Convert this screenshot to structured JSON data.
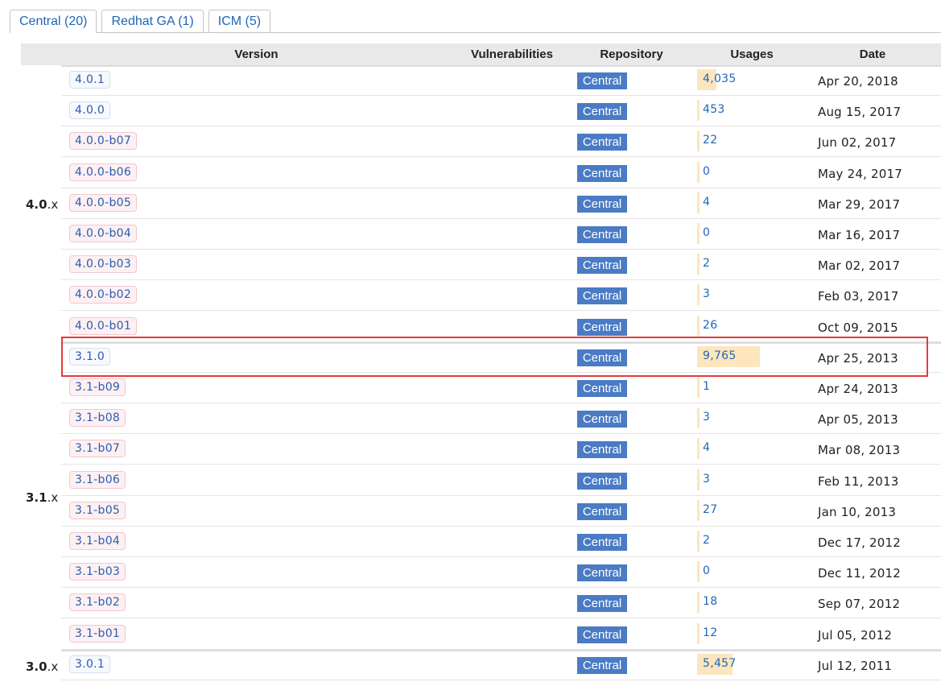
{
  "tabs": [
    {
      "label": "Central (20)",
      "active": true
    },
    {
      "label": "Redhat GA (1)",
      "active": false
    },
    {
      "label": "ICM (5)",
      "active": false
    }
  ],
  "columns": {
    "version": "Version",
    "vulnerabilities": "Vulnerabilities",
    "repository": "Repository",
    "usages": "Usages",
    "date": "Date"
  },
  "groups": [
    {
      "major": "4.0",
      "suffix": ".x"
    },
    {
      "major": "3.1",
      "suffix": ".x"
    },
    {
      "major": "3.0",
      "suffix": ".x"
    }
  ],
  "rows": [
    {
      "version": "4.0.1",
      "release": true,
      "repo": "Central",
      "usages": "4,035",
      "usage_fraction": 0.31,
      "date": "Apr 20, 2018"
    },
    {
      "version": "4.0.0",
      "release": true,
      "repo": "Central",
      "usages": "453",
      "usage_fraction": 0.03,
      "date": "Aug 15, 2017"
    },
    {
      "version": "4.0.0-b07",
      "release": false,
      "repo": "Central",
      "usages": "22",
      "usage_fraction": 0.0,
      "date": "Jun 02, 2017"
    },
    {
      "version": "4.0.0-b06",
      "release": false,
      "repo": "Central",
      "usages": "0",
      "usage_fraction": 0.0,
      "date": "May 24, 2017"
    },
    {
      "version": "4.0.0-b05",
      "release": false,
      "repo": "Central",
      "usages": "4",
      "usage_fraction": 0.0,
      "date": "Mar 29, 2017"
    },
    {
      "version": "4.0.0-b04",
      "release": false,
      "repo": "Central",
      "usages": "0",
      "usage_fraction": 0.0,
      "date": "Mar 16, 2017"
    },
    {
      "version": "4.0.0-b03",
      "release": false,
      "repo": "Central",
      "usages": "2",
      "usage_fraction": 0.0,
      "date": "Mar 02, 2017"
    },
    {
      "version": "4.0.0-b02",
      "release": false,
      "repo": "Central",
      "usages": "3",
      "usage_fraction": 0.0,
      "date": "Feb 03, 2017"
    },
    {
      "version": "4.0.0-b01",
      "release": false,
      "repo": "Central",
      "usages": "26",
      "usage_fraction": 0.0,
      "date": "Oct 09, 2015"
    },
    {
      "version": "3.1.0",
      "release": true,
      "repo": "Central",
      "usages": "9,765",
      "usage_fraction": 1.0,
      "date": "Apr 25, 2013"
    },
    {
      "version": "3.1-b09",
      "release": false,
      "repo": "Central",
      "usages": "1",
      "usage_fraction": 0.0,
      "date": "Apr 24, 2013"
    },
    {
      "version": "3.1-b08",
      "release": false,
      "repo": "Central",
      "usages": "3",
      "usage_fraction": 0.0,
      "date": "Apr 05, 2013"
    },
    {
      "version": "3.1-b07",
      "release": false,
      "repo": "Central",
      "usages": "4",
      "usage_fraction": 0.0,
      "date": "Mar 08, 2013"
    },
    {
      "version": "3.1-b06",
      "release": false,
      "repo": "Central",
      "usages": "3",
      "usage_fraction": 0.0,
      "date": "Feb 11, 2013"
    },
    {
      "version": "3.1-b05",
      "release": false,
      "repo": "Central",
      "usages": "27",
      "usage_fraction": 0.0,
      "date": "Jan 10, 2013"
    },
    {
      "version": "3.1-b04",
      "release": false,
      "repo": "Central",
      "usages": "2",
      "usage_fraction": 0.0,
      "date": "Dec 17, 2012"
    },
    {
      "version": "3.1-b03",
      "release": false,
      "repo": "Central",
      "usages": "0",
      "usage_fraction": 0.0,
      "date": "Dec 11, 2012"
    },
    {
      "version": "3.1-b02",
      "release": false,
      "repo": "Central",
      "usages": "18",
      "usage_fraction": 0.0,
      "date": "Sep 07, 2012"
    },
    {
      "version": "3.1-b01",
      "release": false,
      "repo": "Central",
      "usages": "12",
      "usage_fraction": 0.0,
      "date": "Jul 05, 2012"
    },
    {
      "version": "3.0.1",
      "release": true,
      "repo": "Central",
      "usages": "5,457",
      "usage_fraction": 0.56,
      "date": "Jul 12, 2011"
    }
  ],
  "colors": {
    "tab_text": "#1f66b8",
    "repo_badge": "#4a7bc4",
    "usage_bar": "#fde6bd",
    "highlight_box": "#e63a3a"
  }
}
